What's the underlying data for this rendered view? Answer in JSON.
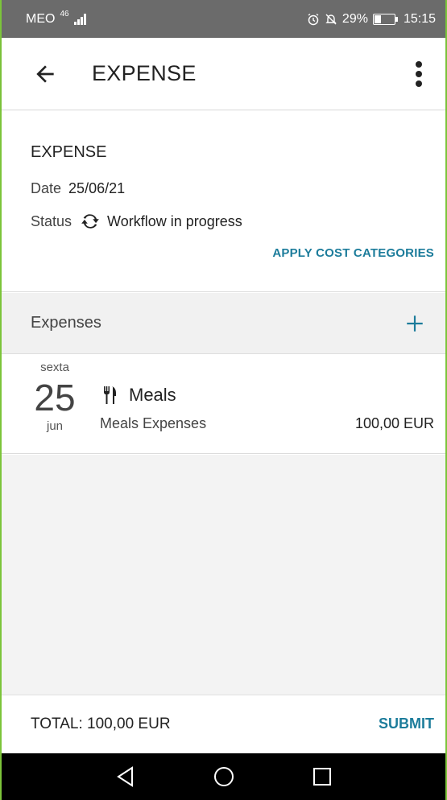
{
  "status_bar": {
    "carrier": "MEO",
    "network": "46",
    "battery": "29%",
    "time": "15:15",
    "icons": [
      "alarm-icon",
      "bell-off-icon",
      "battery-icon",
      "signal-icon"
    ]
  },
  "app_bar": {
    "title": "EXPENSE",
    "back_icon": "arrow-left-icon",
    "more_icon": "more-vertical-icon"
  },
  "header": {
    "title": "EXPENSE",
    "date_label": "Date",
    "date_value": "25/06/21",
    "status_label": "Status",
    "status_value": "Workflow in progress",
    "status_icon": "sync-icon",
    "apply_cost_categories": "APPLY COST CATEGORIES"
  },
  "expenses": {
    "section_label": "Expenses",
    "add_icon": "plus-icon",
    "items": [
      {
        "weekday": "sexta",
        "day": "25",
        "month": "jun",
        "category": "Meals",
        "category_icon": "fork-knife-icon",
        "description": "Meals Expenses",
        "amount": "100,00 EUR"
      }
    ]
  },
  "footer": {
    "total": "TOTAL: 100,00 EUR",
    "submit_label": "SUBMIT"
  },
  "nav_bar": {
    "icons": [
      "nav-back-icon",
      "nav-home-icon",
      "nav-recents-icon"
    ]
  },
  "colors": {
    "accent": "#1c7c9b",
    "status_bar": "#6b6b6b",
    "section_bg": "#f1f1f1",
    "frame": "#7cc43a"
  }
}
